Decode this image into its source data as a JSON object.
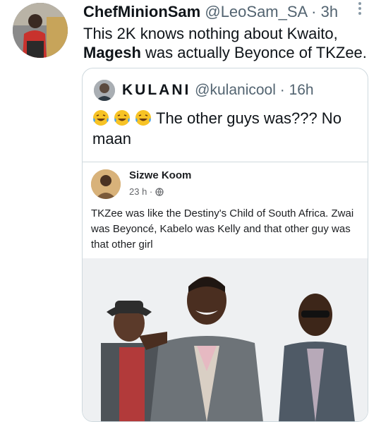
{
  "tweet": {
    "author_name": "ChefMinionSam",
    "author_handle": "@LeoSam_SA",
    "separator": " · ",
    "time": "3h",
    "text_line1": "This 2K knows nothing about Kwaito,",
    "text_bold": "Magesh",
    "text_rest": " was actually Beyonce of TKZee."
  },
  "quoted": {
    "name": "KULANI",
    "handle": "@kulanicool",
    "separator": " · ",
    "time": "16h",
    "emoji_icon": "face-with-tears-of-joy",
    "text": "The other guys was??? No maan"
  },
  "fb_post": {
    "name": "Sizwe Koom",
    "time": "23 h",
    "separator": " · ",
    "privacy_icon": "globe-icon",
    "text": "TKZee was like the Destiny's Child of South Africa. Zwai was Beyoncé, Kabelo was Kelly and that other guy was that other girl"
  },
  "colors": {
    "text": "#0f1419",
    "secondary": "#536471",
    "border": "#cfd9de"
  }
}
